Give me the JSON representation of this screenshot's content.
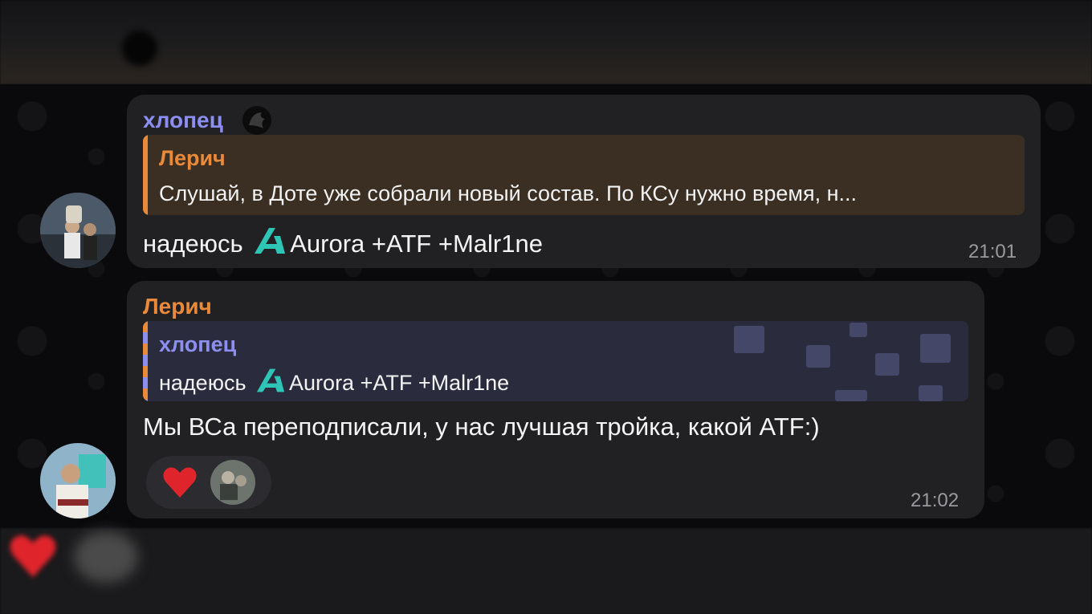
{
  "messages": [
    {
      "sender": "хлопец",
      "reply": {
        "name": "Лерич",
        "text": "Слушай, в Доте уже собрали новый состав. По КСу нужно время, н..."
      },
      "text_before": "надеюсь",
      "text_after": "Aurora +ATF +Malr1ne",
      "time": "21:01"
    },
    {
      "sender": "Лерич",
      "reply": {
        "name": "хлопец",
        "text_before": "надеюсь",
        "text_after": "Aurora +ATF +Malr1ne"
      },
      "text": "Мы ВСа переподписали, у нас лучшая тройка, какой ATF:)",
      "time": "21:02",
      "reaction": "heart"
    }
  ],
  "colors": {
    "name_purple": "#8c8ff0",
    "name_orange": "#e88a3a",
    "aurora_teal": "#2ec4b6",
    "heart_red": "#e0242c"
  },
  "icons": [
    "team-logo-icon",
    "aurora-logo-icon",
    "heart-icon",
    "dota-icon"
  ]
}
